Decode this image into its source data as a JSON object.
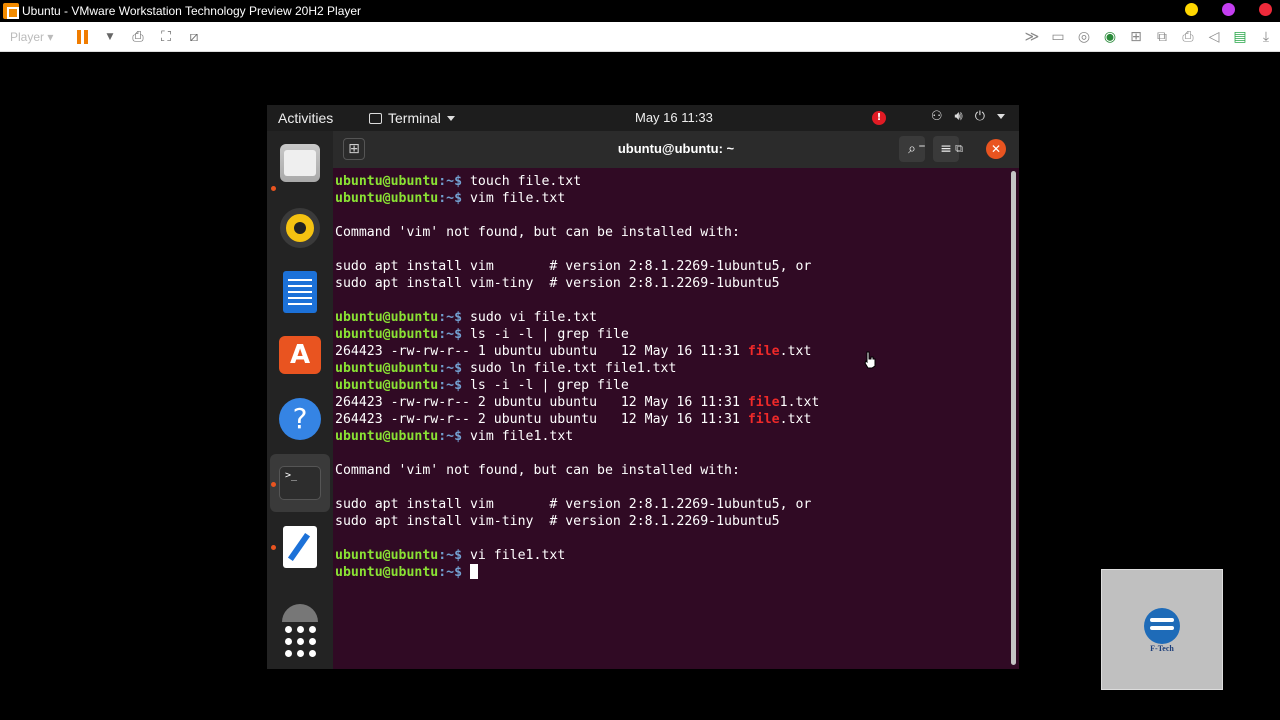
{
  "vm": {
    "title": "Ubuntu - VMware Workstation Technology Preview 20H2 Player",
    "player_menu": "Player",
    "dot_colors": [
      "#ffd700",
      "#c43ef0",
      "#ee2a3a"
    ]
  },
  "ubuntu": {
    "activities": "Activities",
    "app_menu": "Terminal",
    "clock": "May 16  11:33",
    "alert": "!"
  },
  "dock": {
    "items": [
      "files-icon",
      "rhythmbox-icon",
      "writer-icon",
      "software-icon",
      "help-icon",
      "terminal-icon",
      "text-editor-icon",
      "disc-icon",
      "show-apps-icon"
    ],
    "terminal_glyph": ">_",
    "help_glyph": "?",
    "store_glyph": "A"
  },
  "terminal": {
    "title": "ubuntu@ubuntu: ~",
    "prompt_user": "ubuntu@ubuntu",
    "prompt_path": ":~$ ",
    "colors": {
      "bg": "#300a24",
      "user": "#8ae234",
      "match": "#ef2929"
    },
    "lines": [
      {
        "type": "cmd",
        "text": "touch file.txt"
      },
      {
        "type": "cmd",
        "text": "vim file.txt"
      },
      {
        "type": "out",
        "text": ""
      },
      {
        "type": "out",
        "text": "Command 'vim' not found, but can be installed with:"
      },
      {
        "type": "out",
        "text": ""
      },
      {
        "type": "out",
        "text": "sudo apt install vim       # version 2:8.1.2269-1ubuntu5, or"
      },
      {
        "type": "out",
        "text": "sudo apt install vim-tiny  # version 2:8.1.2269-1ubuntu5"
      },
      {
        "type": "out",
        "text": ""
      },
      {
        "type": "cmd",
        "text": "sudo vi file.txt"
      },
      {
        "type": "cmd",
        "text": "ls -i -l | grep file"
      },
      {
        "type": "match",
        "pre": "264423 -rw-rw-r-- 1 ubuntu ubuntu   12 May 16 11:31 ",
        "hl": "file",
        "post": ".txt"
      },
      {
        "type": "cmd",
        "text": "sudo ln file.txt file1.txt"
      },
      {
        "type": "cmd",
        "text": "ls -i -l | grep file"
      },
      {
        "type": "match",
        "pre": "264423 -rw-rw-r-- 2 ubuntu ubuntu   12 May 16 11:31 ",
        "hl": "file",
        "post": "1.txt"
      },
      {
        "type": "match",
        "pre": "264423 -rw-rw-r-- 2 ubuntu ubuntu   12 May 16 11:31 ",
        "hl": "file",
        "post": ".txt"
      },
      {
        "type": "cmd",
        "text": "vim file1.txt"
      },
      {
        "type": "out",
        "text": ""
      },
      {
        "type": "out",
        "text": "Command 'vim' not found, but can be installed with:"
      },
      {
        "type": "out",
        "text": ""
      },
      {
        "type": "out",
        "text": "sudo apt install vim       # version 2:8.1.2269-1ubuntu5, or"
      },
      {
        "type": "out",
        "text": "sudo apt install vim-tiny  # version 2:8.1.2269-1ubuntu5"
      },
      {
        "type": "out",
        "text": ""
      },
      {
        "type": "cmd",
        "text": "vi file1.txt"
      },
      {
        "type": "prompt",
        "text": ""
      }
    ]
  },
  "watermark": {
    "text": "F-Tech"
  }
}
